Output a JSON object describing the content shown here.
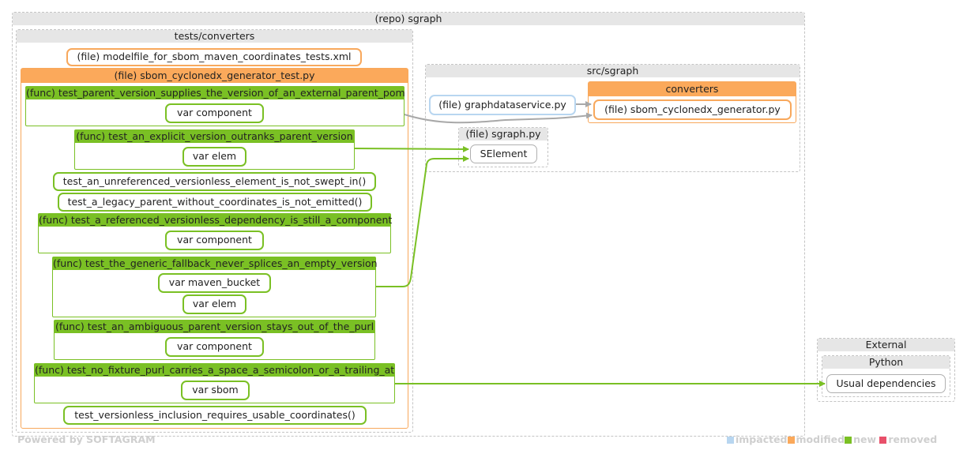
{
  "repo": {
    "title": "(repo) sgraph"
  },
  "tests_group": {
    "title": "tests/converters"
  },
  "modelfile": {
    "label": "(file) modelfile_for_sbom_maven_coordinates_tests.xml"
  },
  "test_file": {
    "title": "(file) sbom_cyclonedx_generator_test.py"
  },
  "funcs": [
    {
      "title": "(func) test_parent_version_supplies_the_version_of_an_external_parent_pom",
      "vars": [
        "var component"
      ]
    },
    {
      "title": "(func) test_an_explicit_version_outranks_parent_version",
      "vars": [
        "var elem"
      ]
    },
    {
      "title": "(func) test_a_referenced_versionless_dependency_is_still_a_component",
      "vars": [
        "var component"
      ]
    },
    {
      "title": "(func) test_the_generic_fallback_never_splices_an_empty_version",
      "vars": [
        "var maven_bucket",
        "var elem"
      ]
    },
    {
      "title": "(func) test_an_ambiguous_parent_version_stays_out_of_the_purl",
      "vars": [
        "var component"
      ]
    },
    {
      "title": "(func) test_no_fixture_purl_carries_a_space_a_semicolon_or_a_trailing_at",
      "vars": [
        "var sbom"
      ]
    }
  ],
  "leaf_tests": [
    "test_an_unreferenced_versionless_element_is_not_swept_in()",
    "test_a_legacy_parent_without_coordinates_is_not_emitted()",
    "test_versionless_inclusion_requires_usable_coordinates()"
  ],
  "src_group": {
    "title": "src/sgraph"
  },
  "graphdataservice": {
    "label": "(file) graphdataservice.py"
  },
  "converters": {
    "title": "converters",
    "file": "(file) sbom_cyclonedx_generator.py"
  },
  "sgraph_file": {
    "title": "(file) sgraph.py",
    "element": "SElement"
  },
  "external": {
    "title": "External",
    "python": "Python",
    "deps": "Usual dependencies"
  },
  "footer": "Powered by SOFTAGRAM",
  "legend": [
    {
      "label": "impacted",
      "color": "#b8d6f0"
    },
    {
      "label": "modified",
      "color": "#fba95b"
    },
    {
      "label": "new",
      "color": "#7ac024"
    },
    {
      "label": "removed",
      "color": "#e8506a"
    }
  ],
  "colors": {
    "new": "#7ac024",
    "modified": "#fba95b",
    "impacted": "#b8d6f0",
    "dependency_edge": "#a8a8a8"
  }
}
